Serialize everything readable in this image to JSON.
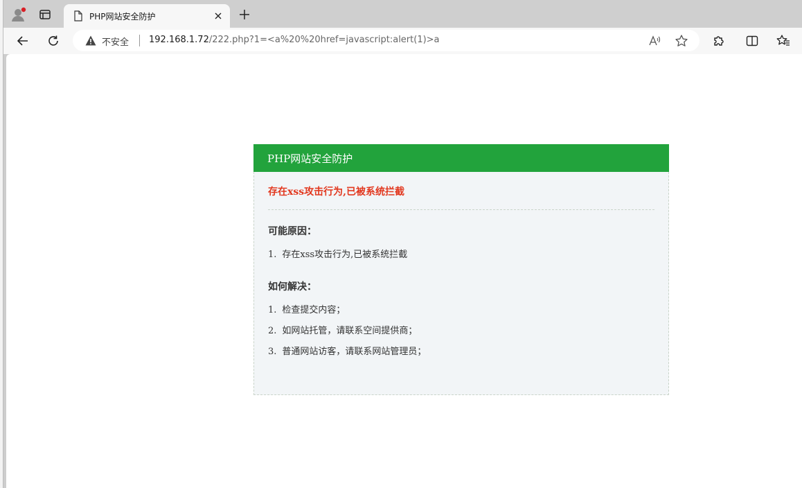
{
  "tab": {
    "title": "PHP网站安全防护"
  },
  "address_bar": {
    "security_label": "不安全",
    "url_host": "192.168.1.72",
    "url_rest": "/222.php?1=<a%20%20href=javascript:alert(1)>a"
  },
  "panel": {
    "header": "PHP网站安全防护",
    "alert": "存在xss攻击行为,已被系统拦截",
    "causes_title": "可能原因：",
    "causes": [
      {
        "num": "1.",
        "text": "存在xss攻击行为,已被系统拦截"
      }
    ],
    "solutions_title": "如何解决：",
    "solutions": [
      {
        "num": "1.",
        "text": "检查提交内容；"
      },
      {
        "num": "2.",
        "text": "如网站托管，请联系空间提供商；"
      },
      {
        "num": "3.",
        "text": "普通网站访客，请联系网站管理员；"
      }
    ]
  },
  "colors": {
    "header_green": "#22a33c",
    "alert_red": "#e2381f",
    "panel_bg": "#f2f5f7"
  }
}
